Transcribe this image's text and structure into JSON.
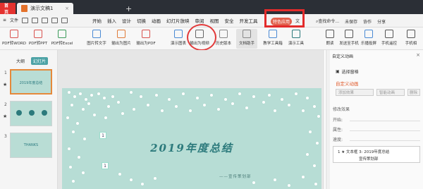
{
  "titlebar": {
    "home_tab": "首页",
    "doc_tab": "演示文稿1"
  },
  "menubar": {
    "quick_labels": [
      "文件"
    ],
    "items": [
      "开始",
      "插入",
      "设计",
      "切换",
      "动画",
      "幻灯片放映",
      "审阅",
      "视图",
      "安全",
      "开发工具"
    ],
    "special": "特色应用",
    "overflow": "文",
    "search_placeholder": "查找命令...",
    "right_items": [
      "未保存",
      "协作",
      "分享"
    ]
  },
  "ribbon": {
    "buttons": [
      "PDF转WORD",
      "PDF转PPT",
      "PDF转Excel",
      "图片转文字",
      "输出为图片",
      "输出为PDF",
      "演示图表",
      "输出为视频",
      "历史版本",
      "文档助手",
      "教学工具箱",
      "演示工具",
      "朗读",
      "发送至手机",
      "乐播投屏",
      "手机遥控",
      "手机相"
    ]
  },
  "left_panel": {
    "tabs": [
      "大纲",
      "幻灯片"
    ],
    "thumbs": [
      {
        "num": "1",
        "star": "★",
        "text": "2019年度总结"
      },
      {
        "num": "2",
        "star": "★",
        "text": ""
      },
      {
        "num": "3",
        "star": "",
        "text": "THANKS"
      }
    ]
  },
  "slide": {
    "title": "2019年度总结",
    "subtitle": "——宣传策划部",
    "marker1": "1",
    "marker2": "1"
  },
  "right_panel": {
    "header": "自定义动画",
    "select_pane": "选择窗格",
    "custom_anim": "自定义动画",
    "add_effect": "添加效果",
    "smart_anim": "智能动画",
    "delete": "删除",
    "modify_section": "修改效果",
    "fields": [
      "开始:",
      "属性:",
      "速度:"
    ],
    "list_item1": "1 ★ 文本框 3: 2019年度总结",
    "list_item2": "宣传策划部"
  },
  "colors": {
    "accent": "#e4322f",
    "teal": "#2c7a7c",
    "slide_bg": "#b7ddd5",
    "highlight_box": "#e32b2b"
  }
}
